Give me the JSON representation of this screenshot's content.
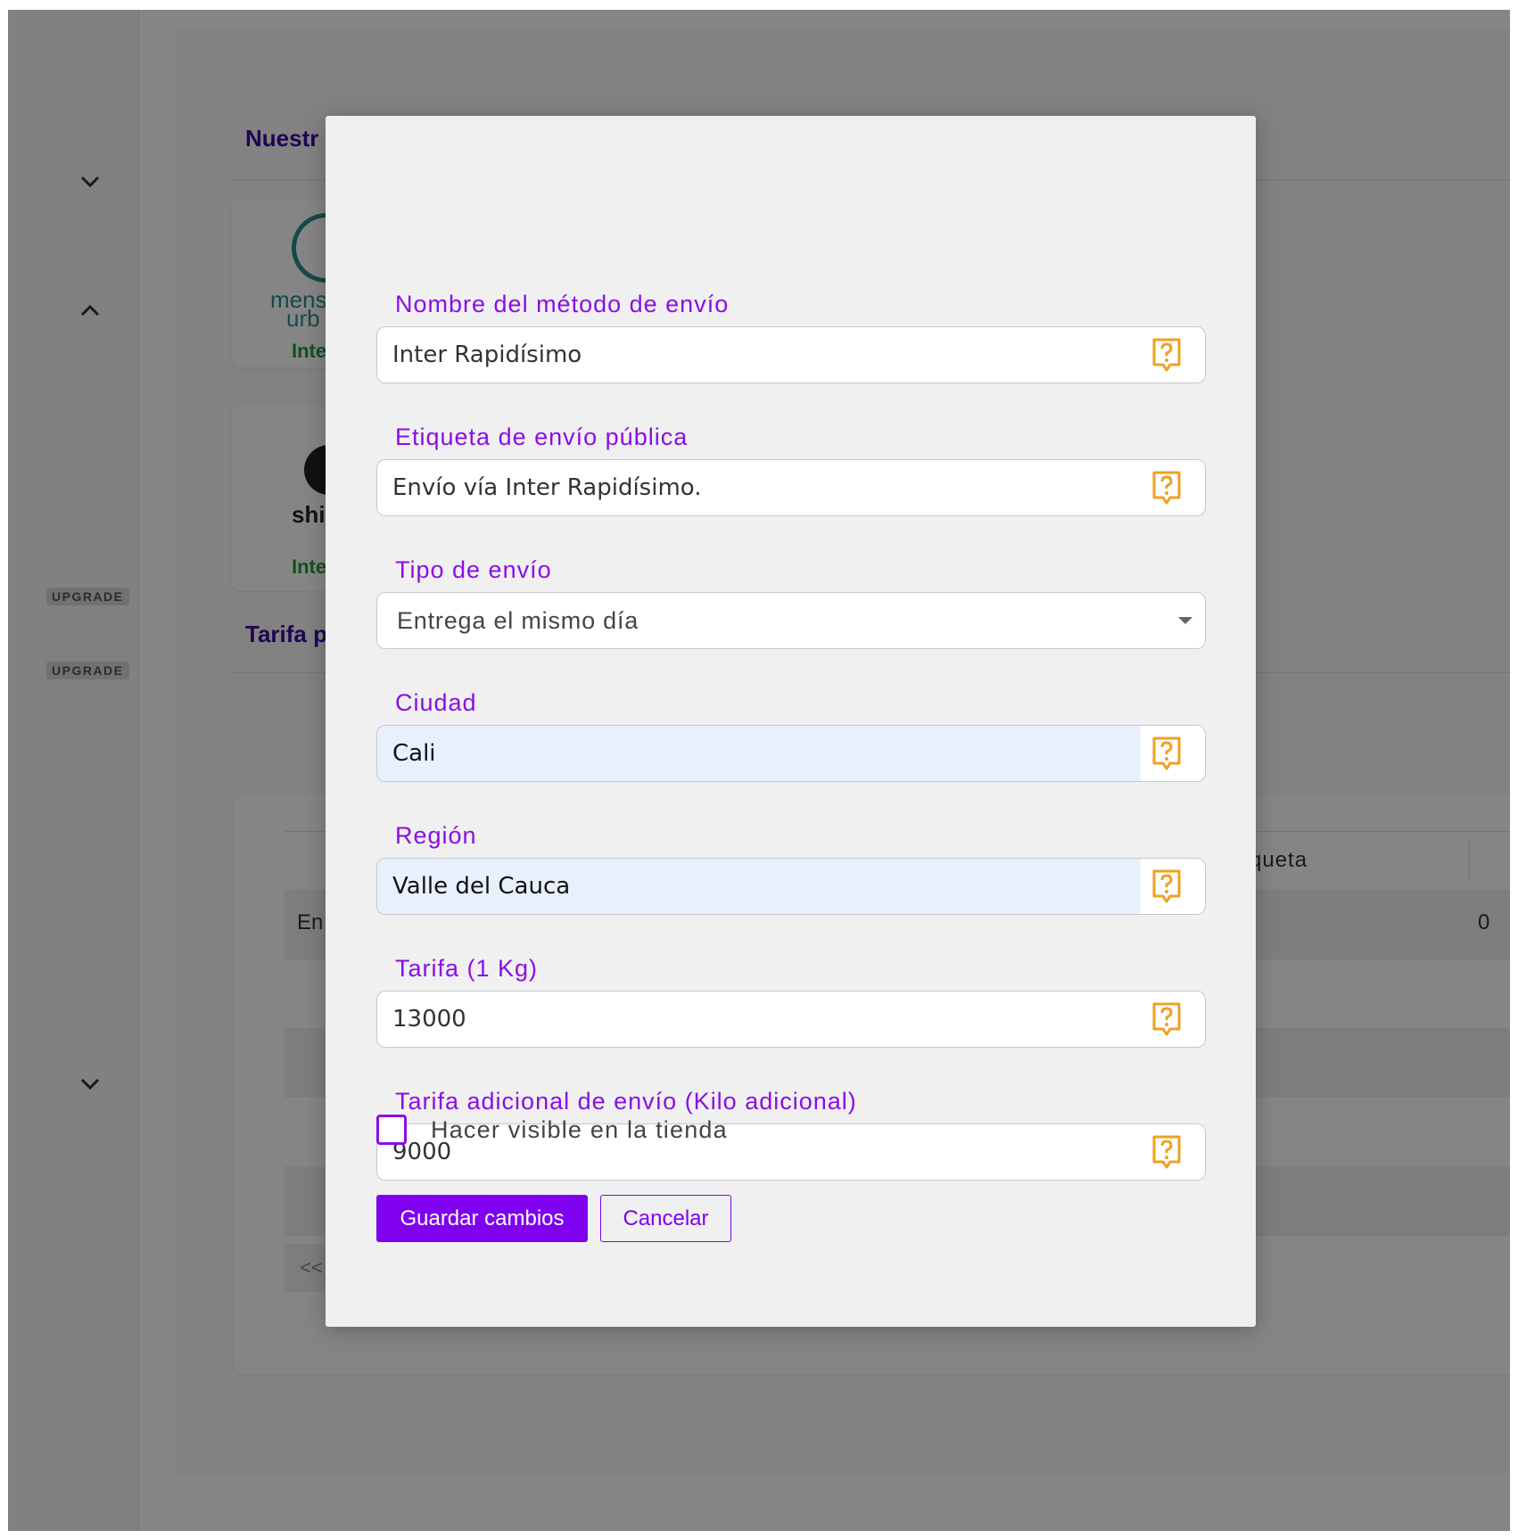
{
  "background": {
    "section_title_1": "Nuestr",
    "section_title_2": "Tarifa p",
    "card1_logo_line1": "mens",
    "card1_logo_line2": "urb",
    "card1_status": "Inte",
    "card2_logo_text": "shi",
    "card2_status": "Inte",
    "badges": [
      "UPGRADE",
      "UPGRADE"
    ],
    "table_header_partial": "queta",
    "table_row_partial": "En",
    "table_row_value": "0",
    "pagination_prev": "<<"
  },
  "modal": {
    "fields": [
      {
        "label": "Nombre del método de envío",
        "value": "Inter Rapidísimo",
        "autofill": false
      },
      {
        "label": "Etiqueta de envío pública",
        "value": "Envío vía Inter Rapidísimo.",
        "autofill": false
      },
      {
        "label": "Ciudad",
        "value": "Cali",
        "autofill": true
      },
      {
        "label": "Región",
        "value": "Valle del Cauca",
        "autofill": true
      },
      {
        "label": "Tarifa (1 Kg)",
        "value": "13000",
        "autofill": false
      },
      {
        "label": "Tarifa adicional de envío (Kilo adicional)",
        "value": "9000",
        "autofill": false
      }
    ],
    "shipping_type": {
      "label": "Tipo de envío",
      "selected": "Entrega el mismo día"
    },
    "visible_checkbox": {
      "label": "Hacer visible en la tienda",
      "checked": false
    },
    "save_label": "Guardar cambios",
    "cancel_label": "Cancelar"
  },
  "colors": {
    "label_purple": "#8a0ee6",
    "primary_button": "#8000f0",
    "help_icon_orange": "#f0a020",
    "autofill_bg": "#e8f0fe"
  },
  "icons": {
    "help": "help-bubble-icon",
    "chevron": "chevron-icon",
    "dropdown": "caret-down-icon"
  }
}
